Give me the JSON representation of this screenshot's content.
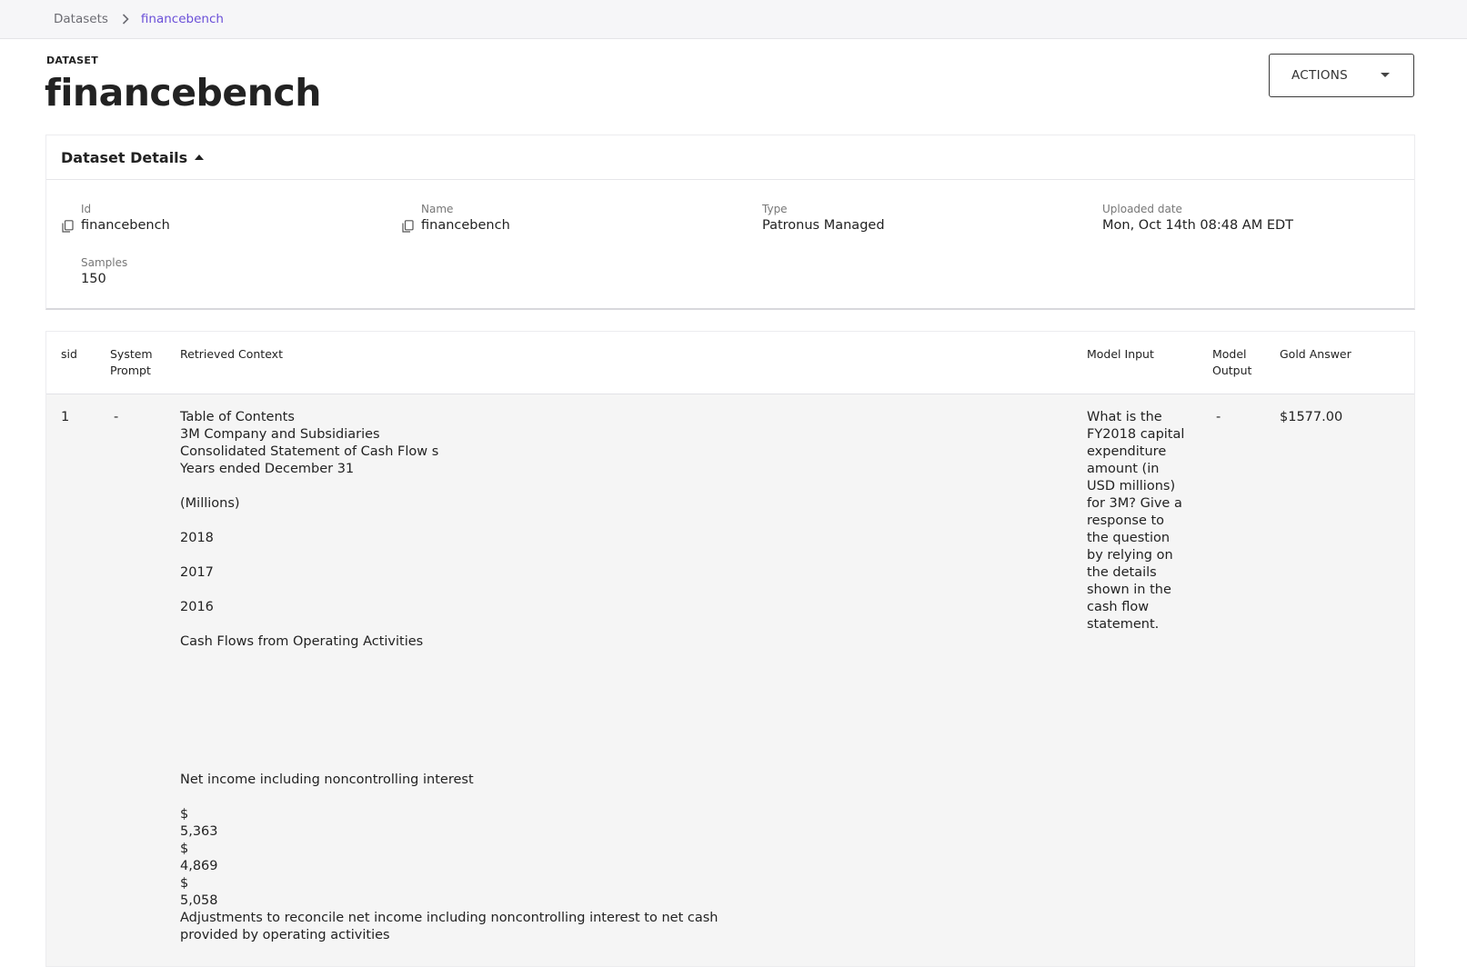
{
  "breadcrumb": {
    "root": "Datasets",
    "current": "financebench"
  },
  "header": {
    "eyebrow": "DATASET",
    "title": "financebench",
    "actions_label": "ACTIONS"
  },
  "details": {
    "section_title": "Dataset Details",
    "fields": {
      "id": {
        "label": "Id",
        "value": "financebench"
      },
      "name": {
        "label": "Name",
        "value": "financebench"
      },
      "type": {
        "label": "Type",
        "value": "Patronus Managed"
      },
      "uploaded": {
        "label": "Uploaded date",
        "value": "Mon, Oct 14th 08:48 AM EDT"
      },
      "samples": {
        "label": "Samples",
        "value": "150"
      }
    }
  },
  "table": {
    "columns": {
      "sid": "sid",
      "system_prompt": "System\nPrompt",
      "retrieved_context": "Retrieved Context",
      "model_input": "Model Input",
      "model_output": "Model\nOutput",
      "gold_answer": "Gold Answer"
    },
    "rows": [
      {
        "sid": "1",
        "system_prompt": "-",
        "retrieved_context": "Table of Contents\n3M Company and Subsidiaries\nConsolidated Statement of Cash Flow s\nYears ended December 31\n\n(Millions)\n\n2018\n\n2017\n\n2016\n\nCash Flows from Operating Activities\n\n\n\n\n\n\n\nNet income including noncontrolling interest\n\n$\n5,363\n$\n4,869\n$\n5,058\nAdjustments to reconcile net income including noncontrolling interest to net cash\nprovided by operating activities",
        "model_input": "What is the\nFY2018 capital\nexpenditure\namount (in\nUSD millions)\nfor 3M? Give a\nresponse to\nthe question\nby relying on\nthe details\nshown in the\ncash flow\nstatement.",
        "model_output": "-",
        "gold_answer": "$1577.00"
      }
    ]
  }
}
